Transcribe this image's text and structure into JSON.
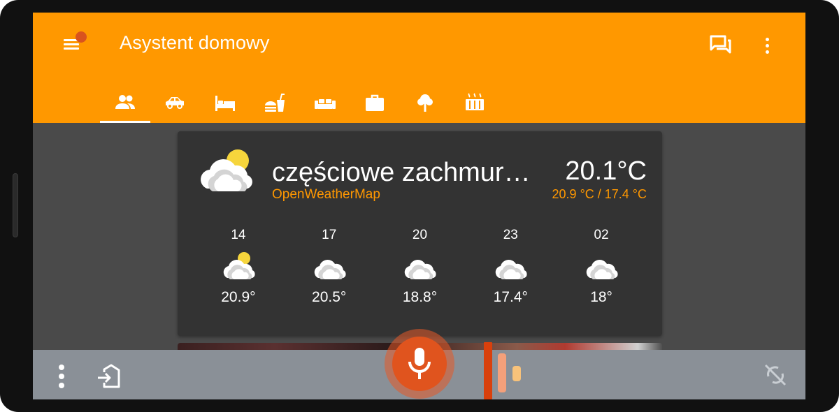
{
  "app": {
    "title": "Asystent domowy"
  },
  "header": {
    "tabs": [
      {
        "icon": "people-icon",
        "active": true
      },
      {
        "icon": "car-icon",
        "active": false
      },
      {
        "icon": "bed-icon",
        "active": false
      },
      {
        "icon": "food-icon",
        "active": false
      },
      {
        "icon": "sofa-icon",
        "active": false
      },
      {
        "icon": "briefcase-icon",
        "active": false
      },
      {
        "icon": "tree-icon",
        "active": false
      },
      {
        "icon": "heater-icon",
        "active": false
      }
    ],
    "actions": [
      "chat-icon",
      "more-vertical-icon"
    ]
  },
  "weather": {
    "condition": "częściowe zachmurzenie",
    "provider": "OpenWeatherMap",
    "temperature": "20.1°C",
    "minmax": "20.9 °C / 17.4 °C",
    "forecast": [
      {
        "hour": "14",
        "temp": "20.9°",
        "icon": "partly-cloudy-icon"
      },
      {
        "hour": "17",
        "temp": "20.5°",
        "icon": "cloudy-icon"
      },
      {
        "hour": "20",
        "temp": "18.8°",
        "icon": "cloudy-icon"
      },
      {
        "hour": "23",
        "temp": "17.4°",
        "icon": "cloudy-icon"
      },
      {
        "hour": "02",
        "temp": "18°",
        "icon": "cloudy-icon"
      }
    ]
  },
  "bottom_bar": {
    "icons": [
      "more-vertical-icon",
      "exit-home-icon",
      "microphone-icon",
      "sync-disabled-icon"
    ]
  },
  "colors": {
    "accent": "#ff9800",
    "mic": "#e0541e",
    "card": "#333333",
    "background": "#4a4a4a",
    "bottom_bar": "#8a9097"
  }
}
